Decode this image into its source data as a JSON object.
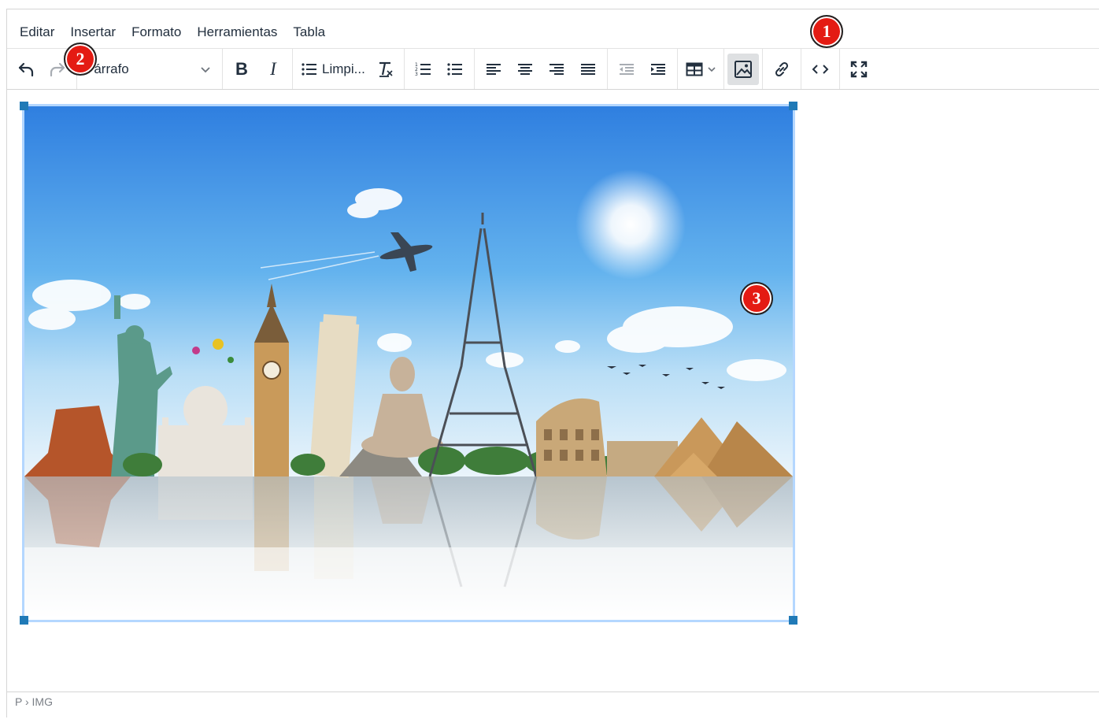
{
  "menubar": {
    "items": [
      "Editar",
      "Insertar",
      "Formato",
      "Herramientas",
      "Tabla"
    ]
  },
  "toolbar": {
    "block_format": "Párrafo",
    "bold_label": "B",
    "italic_label": "I",
    "list_style_label": "Limpi...",
    "icons": [
      "undo-icon",
      "redo-icon",
      "bold-icon",
      "italic-icon",
      "bullet-list-icon",
      "clear-formatting-icon",
      "numbered-list-icon",
      "bullet-list-icon",
      "align-left-icon",
      "align-center-icon",
      "align-right-icon",
      "align-justify-icon",
      "outdent-icon",
      "indent-icon",
      "table-icon",
      "image-icon",
      "link-icon",
      "code-icon",
      "fullscreen-icon"
    ]
  },
  "status": {
    "path": "P › IMG"
  },
  "badges": [
    "1",
    "2",
    "3"
  ],
  "colors": {
    "accent": "#207ab7",
    "badge": "#e41b13",
    "selection": "#b4d7ff"
  }
}
